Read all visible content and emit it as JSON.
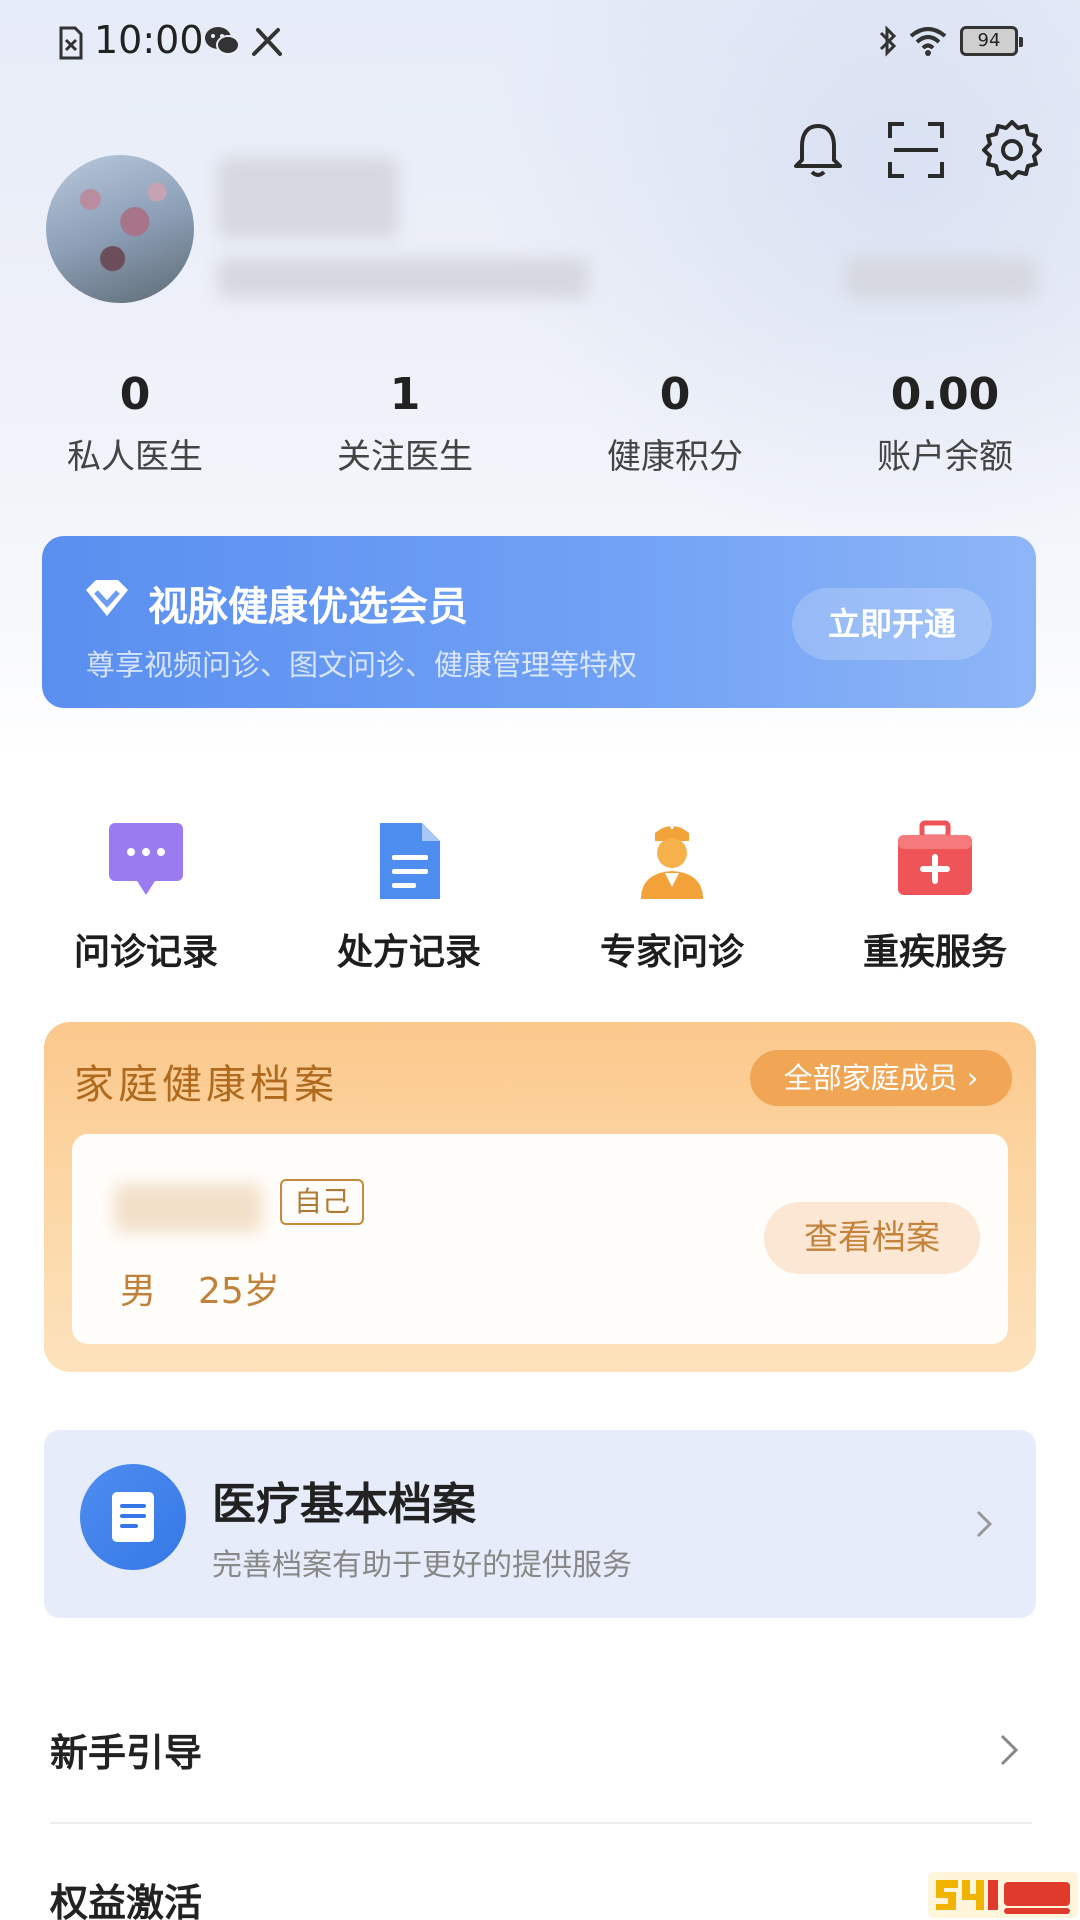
{
  "status_bar": {
    "time": "10:00",
    "battery": "94",
    "icons": [
      "sim-off-icon",
      "wechat-icon",
      "tools-icon",
      "bluetooth-icon",
      "wifi-icon",
      "battery-icon"
    ]
  },
  "header": {
    "icons": [
      "bell-icon",
      "scan-icon",
      "settings-icon"
    ]
  },
  "stats": [
    {
      "value": "0",
      "label": "私人医生"
    },
    {
      "value": "1",
      "label": "关注医生"
    },
    {
      "value": "0",
      "label": "健康积分"
    },
    {
      "value": "0.00",
      "label": "账户余额"
    }
  ],
  "member_banner": {
    "title": "视脉健康优选会员",
    "subtitle": "尊享视频问诊、图文问诊、健康管理等特权",
    "button": "立即开通"
  },
  "quick_actions": [
    {
      "label": "问诊记录",
      "icon": "chat-bubble-icon"
    },
    {
      "label": "处方记录",
      "icon": "document-icon"
    },
    {
      "label": "专家问诊",
      "icon": "nurse-icon"
    },
    {
      "label": "重疾服务",
      "icon": "medical-kit-icon"
    }
  ],
  "family": {
    "title": "家庭健康档案",
    "all_members": "全部家庭成员 ›",
    "member": {
      "badge": "自己",
      "gender": "男",
      "age": "25岁",
      "view_button": "查看档案"
    }
  },
  "medical": {
    "title": "医疗基本档案",
    "subtitle": "完善档案有助于更好的提供服务"
  },
  "list": [
    {
      "label": "新手引导"
    },
    {
      "label": "权益激活"
    }
  ],
  "colors": {
    "brand_blue": "#5a8ff0",
    "family_orange": "#f1a655",
    "qa_purple": "#9b7cf0",
    "qa_blue": "#4e8ef0",
    "qa_orange": "#f3a23a",
    "qa_red": "#ef5558"
  }
}
